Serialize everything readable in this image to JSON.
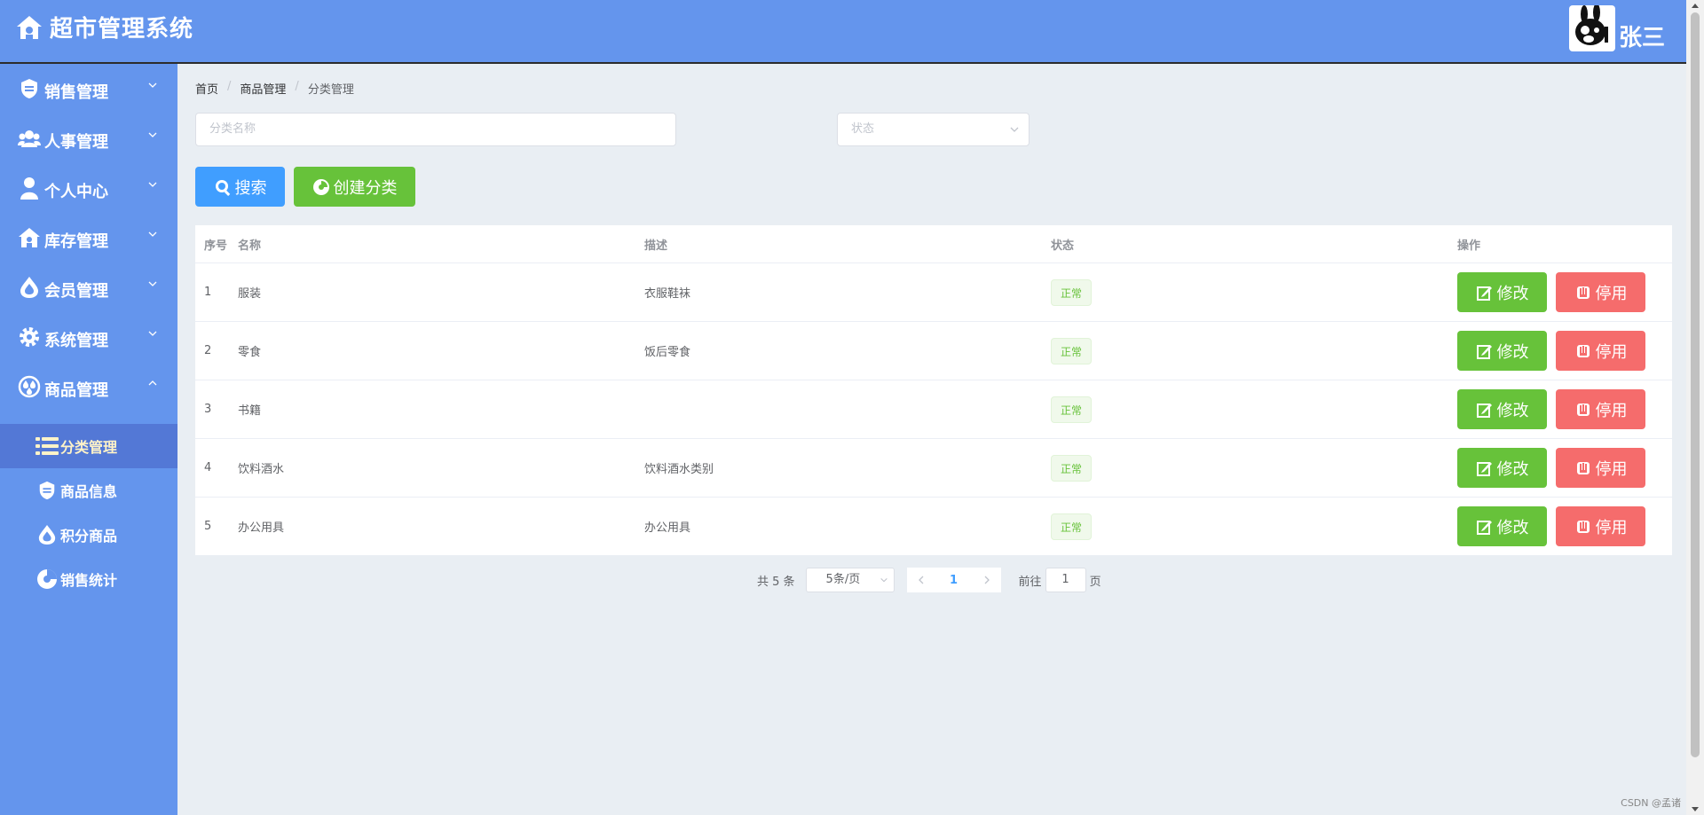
{
  "app": {
    "title": "超市管理系统"
  },
  "user": {
    "name": "张三"
  },
  "sidebar": {
    "menus": [
      {
        "label": "销售管理",
        "icon": "shield-icon"
      },
      {
        "label": "人事管理",
        "icon": "people-icon"
      },
      {
        "label": "个人中心",
        "icon": "person-icon"
      },
      {
        "label": "库存管理",
        "icon": "warehouse-icon"
      },
      {
        "label": "会员管理",
        "icon": "drop-icon"
      },
      {
        "label": "系统管理",
        "icon": "gear-icon"
      },
      {
        "label": "商品管理",
        "icon": "goods-icon"
      }
    ],
    "submenu": [
      {
        "label": "分类管理",
        "icon": "list-icon",
        "active": true
      },
      {
        "label": "商品信息",
        "icon": "shield-icon"
      },
      {
        "label": "积分商品",
        "icon": "drop-icon"
      },
      {
        "label": "销售统计",
        "icon": "chart-icon"
      }
    ]
  },
  "breadcrumb": {
    "home": "首页",
    "level1": "商品管理",
    "level2": "分类管理"
  },
  "filters": {
    "name_placeholder": "分类名称",
    "status_placeholder": "状态"
  },
  "actions": {
    "search_label": "搜索",
    "create_label": "创建分类"
  },
  "table": {
    "headers": {
      "index": "序号",
      "name": "名称",
      "desc": "描述",
      "status": "状态",
      "ops": "操作"
    },
    "rows": [
      {
        "index": "1",
        "name": "服装",
        "desc": "衣服鞋袜",
        "status": "正常"
      },
      {
        "index": "2",
        "name": "零食",
        "desc": "饭后零食",
        "status": "正常"
      },
      {
        "index": "3",
        "name": "书籍",
        "desc": "",
        "status": "正常"
      },
      {
        "index": "4",
        "name": "饮料酒水",
        "desc": "饮料酒水类别",
        "status": "正常"
      },
      {
        "index": "5",
        "name": "办公用具",
        "desc": "办公用具",
        "status": "正常"
      }
    ],
    "edit_label": "修改",
    "disable_label": "停用"
  },
  "pagination": {
    "total_text": "共 5 条",
    "page_size": "5条/页",
    "current_page": "1",
    "goto_prefix": "前往",
    "goto_value": "1",
    "goto_suffix": "页"
  },
  "watermark": "CSDN @孟诸",
  "colors": {
    "primary_blue": "#6495ed",
    "search_blue": "#409eff",
    "success_green": "#67c23a",
    "danger_red": "#f56c6c"
  }
}
